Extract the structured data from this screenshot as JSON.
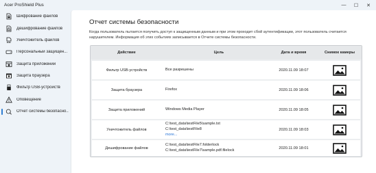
{
  "window": {
    "title": "Acer ProShield Plus",
    "minimize_glyph": "—",
    "maximize_glyph": "☐",
    "close_glyph": "✕"
  },
  "sidebar": {
    "items": [
      {
        "label": "Шифрование файлов",
        "icon": "file-lock-icon"
      },
      {
        "label": "Дешифрование файлов",
        "icon": "file-unlock-icon"
      },
      {
        "label": "Уничтожитель файлов",
        "icon": "file-shred-icon"
      },
      {
        "label": "Персональный защищен...",
        "icon": "drive-icon"
      },
      {
        "label": "Защита приложений",
        "icon": "app-shield-icon"
      },
      {
        "label": "Защита браузера",
        "icon": "browser-shield-icon"
      },
      {
        "label": "Фильтр USB-устройств",
        "icon": "usb-icon"
      },
      {
        "label": "Оповещение",
        "icon": "alert-icon"
      },
      {
        "label": "Отчет системы безопасно...",
        "icon": "report-icon",
        "active": true
      }
    ]
  },
  "main": {
    "title": "Отчет системы безопасности",
    "description": "Когда пользователь пытается получить доступ к защищенным данным и при этом проходит сбой аутентификации, этот пользователь считается нарушителем. Информация об этих событиях записывается в Отчете системы безопасности.",
    "table": {
      "headers": {
        "action": "Действие",
        "target": "Цель",
        "datetime": "Дата и время",
        "camera": "Снимок камеры"
      },
      "rows": [
        {
          "action": "Фильтр USB-устройств",
          "targets": [
            "Все разрешены"
          ],
          "more": "",
          "datetime": "2020.11.09 18:07"
        },
        {
          "action": "Защита браузера",
          "targets": [
            "Firefox"
          ],
          "more": "",
          "datetime": "2020.11.09 18:06"
        },
        {
          "action": "Защита приложений",
          "targets": [
            "Windows Media Player"
          ],
          "more": "",
          "datetime": "2020.11.09 18:05"
        },
        {
          "action": "Уничтожитель файлов",
          "targets": [
            "C:\\test_data\\testFile5\\sample.txt",
            "C:\\test_data\\testFile8"
          ],
          "more": "more...",
          "datetime": "2020.11.09 18:03"
        },
        {
          "action": "Дешифрование файлов",
          "targets": [
            "C:\\test_data\\testFile7.folderlock",
            "C:\\test_data\\testFile7\\sample.pdf.filelock"
          ],
          "more": "",
          "datetime": "2020.11.09 18:01"
        }
      ]
    }
  },
  "colors": {
    "accent": "#2d7dd2",
    "link": "#1f6fd6",
    "sidebar_bg": "#eef3f8",
    "table_bg": "#eceef0"
  }
}
